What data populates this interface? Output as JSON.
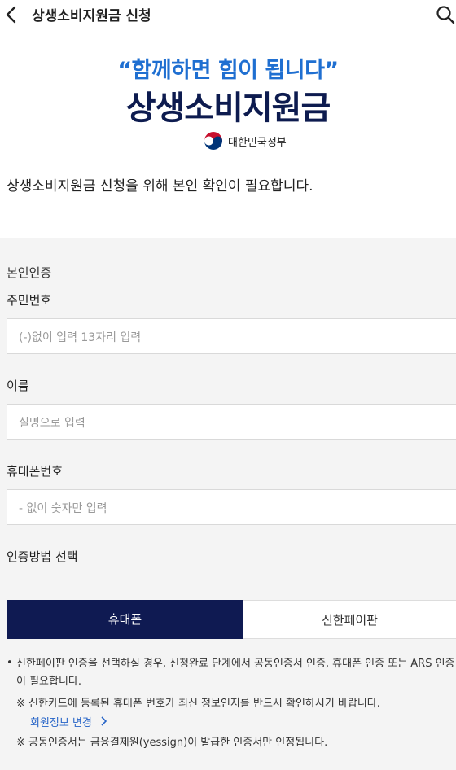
{
  "header": {
    "title": "상생소비지원금 신청",
    "back_icon": "chevron-left-icon",
    "search_icon": "search-icon"
  },
  "banner": {
    "slogan": "“함께하면 힘이 됩니다”",
    "title": "상생소비지원금",
    "gov_text": "대한민국정부"
  },
  "intro_text": "상생소비지원금 신청을 위해 본인 확인이 필요합니다.",
  "form": {
    "section_label": "본인인증",
    "rrn_label": "주민번호",
    "rrn_placeholder": "(-)없이 입력 13자리 입력",
    "name_label": "이름",
    "name_placeholder": "실명으로 입력",
    "phone_label": "휴대폰번호",
    "phone_placeholder": "- 없이 숫자만 입력",
    "method_label": "인증방법 선택"
  },
  "tabs": [
    {
      "label": "휴대폰",
      "selected": true
    },
    {
      "label": "신한페이판",
      "selected": false
    }
  ],
  "notes": {
    "main": "신한페이판 인증을 선택하실 경우, 신청완료 단계에서 공동인증서 인증, 휴대폰 인증 또는 ARS 인증이 필요합니다.",
    "sub1": "※  신한카드에 등록된 휴대폰 번호가 최신 정보인지를 반드시 확인하시기 바랍니다.",
    "link": "회원정보 변경",
    "sub2": "※  공동인증서는 금융결제원(yessign)이 발급한 인증서만 인정됩니다."
  },
  "colors": {
    "brand_navy": "#0f1a52",
    "slogan_blue": "#1f6fd1",
    "link_blue": "#2563c7",
    "gray_bg": "#f4f4f4"
  }
}
